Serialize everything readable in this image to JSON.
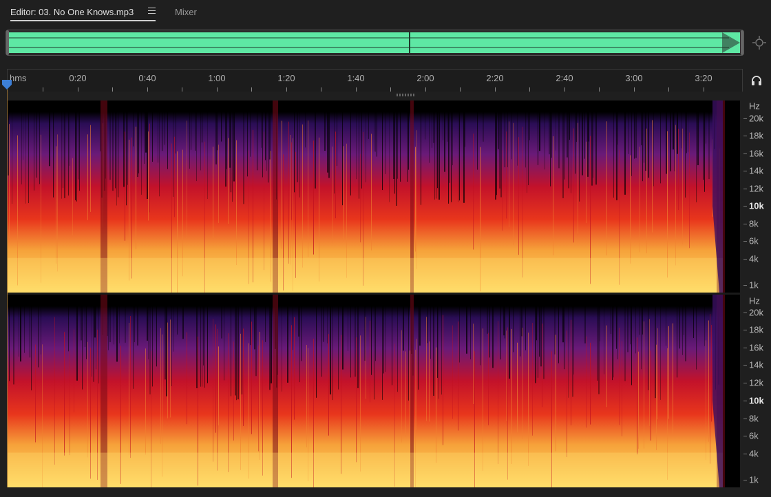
{
  "tabs": [
    {
      "label": "Editor: 03. No One Knows.mp3",
      "active": true
    },
    {
      "label": "Mixer",
      "active": false
    }
  ],
  "icons": {
    "menu": "hamburger-menu-icon",
    "zoom": "zoom-navigator-icon",
    "headphones": "headphones-icon",
    "playhead": "playhead-marker-icon"
  },
  "ruler": {
    "unit": "hms",
    "labels": [
      "0:20",
      "0:40",
      "1:00",
      "1:20",
      "1:40",
      "2:00",
      "2:20",
      "2:40",
      "3:00",
      "3:20"
    ]
  },
  "frequency_axis": {
    "unit": "Hz",
    "labels": [
      "20k",
      "18k",
      "16k",
      "14k",
      "12k",
      "10k",
      "8k",
      "6k",
      "4k",
      "1k"
    ],
    "bold_label": "10k"
  },
  "colors": {
    "waveform": "#5ee8a4",
    "background": "#1f1f1f",
    "spectrogram_low": "#ffd060",
    "spectrogram_mid": "#e02020",
    "spectrogram_high": "#3a1060"
  }
}
